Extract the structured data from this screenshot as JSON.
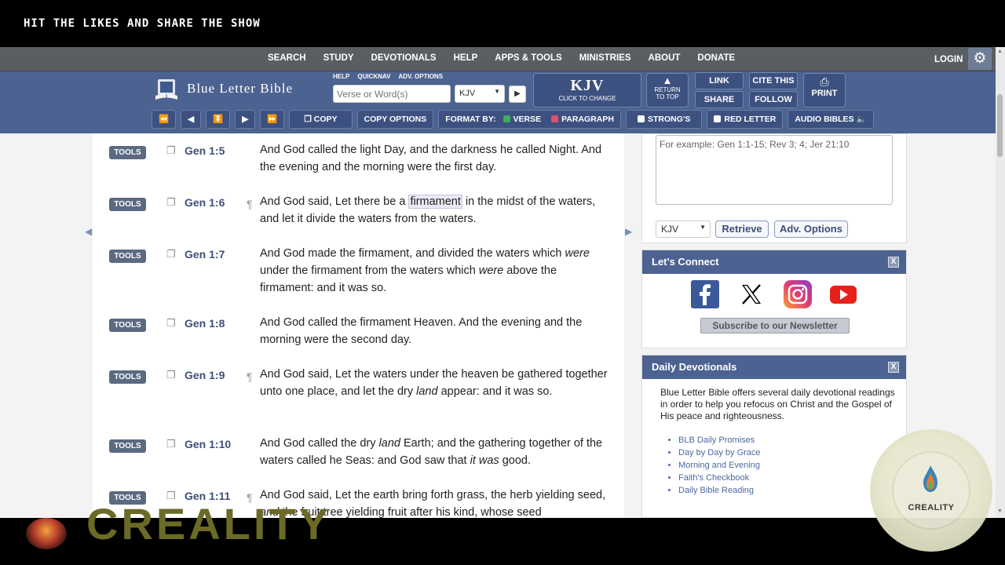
{
  "banner": {
    "text": "HIT THE LIKES AND SHARE THE SHOW"
  },
  "topnav": {
    "items": [
      "SEARCH",
      "STUDY",
      "DEVOTIONALS",
      "HELP",
      "APPS & TOOLS",
      "MINISTRIES",
      "ABOUT",
      "DONATE"
    ],
    "login": "LOGIN",
    "gear_icon": "gear-icon"
  },
  "header": {
    "logo_text": "Blue Letter Bible",
    "mini_links": [
      "HELP",
      "QUICKNAV",
      "ADV. OPTIONS"
    ],
    "search_placeholder": "Verse or Word(s)",
    "version": "KJV",
    "kjv_big": "KJV",
    "kjv_small": "CLICK TO CHANGE",
    "return_line1": "RETURN",
    "return_line2": "TO TOP",
    "link": "LINK",
    "cite": "CITE THIS",
    "share": "SHARE",
    "follow": "FOLLOW",
    "print": "PRINT"
  },
  "toolbar": {
    "copy": "COPY",
    "copy_options": "COPY OPTIONS",
    "format_by": "FORMAT BY:",
    "verse": "VERSE",
    "paragraph": "PARAGRAPH",
    "strongs": "STRONG'S",
    "red_letter": "RED LETTER",
    "audio": "AUDIO BIBLES"
  },
  "tools_label": "TOOLS",
  "verses": [
    {
      "ref": "Gen 1:5",
      "para": false,
      "html": "And God called the light Day, and the darkness he called Night. And the evening and the morning were the first day."
    },
    {
      "ref": "Gen 1:6",
      "para": true,
      "html": "And God said, Let there be a <span class=\"hl\">firmament</span> in the midst of the waters, and let it divide the waters from the waters."
    },
    {
      "ref": "Gen 1:7",
      "para": false,
      "html": "And God made the firmament, and divided the waters which <em>were</em> under the firmament from the waters which <em>were</em> above the firmament: and it was so."
    },
    {
      "ref": "Gen 1:8",
      "para": false,
      "html": "And God called the firmament Heaven. And the evening and the morning were the second day."
    },
    {
      "ref": "Gen 1:9",
      "para": true,
      "html": "And God said, Let the waters under the heaven be gathered together unto one place, and let the dry <em>land</em> appear: and it was so."
    },
    {
      "ref": "Gen 1:10",
      "para": false,
      "html": "And God called the dry <em>land</em> Earth; and the gathering together of the waters called he Seas: and God saw that <em>it was</em> good."
    },
    {
      "ref": "Gen 1:11",
      "para": true,
      "html": "And God said, Let the earth bring forth grass, the herb yielding seed, <em>and</em> the fruit tree yielding fruit after his kind, whose seed"
    }
  ],
  "sidebar": {
    "search_placeholder": "For example: Gen 1:1-15; Rev 3; 4; Jer 21:10",
    "version": "KJV",
    "retrieve": "Retrieve",
    "adv_options": "Adv. Options",
    "connect_title": "Let's Connect",
    "close": "X",
    "newsletter": "Subscribe to our Newsletter",
    "devo_title": "Daily Devotionals",
    "devo_text": "Blue Letter Bible offers several daily devotional readings in order to help you refocus on Christ and the Gospel of His peace and righteousness.",
    "devo_items": [
      "BLB Daily Promises",
      "Day by Day by Grace",
      "Morning and Evening",
      "Faith's Checkbook",
      "Daily Bible Reading"
    ]
  },
  "watermark": {
    "text": "CREALITY",
    "ghost_text": "CREALITY"
  }
}
